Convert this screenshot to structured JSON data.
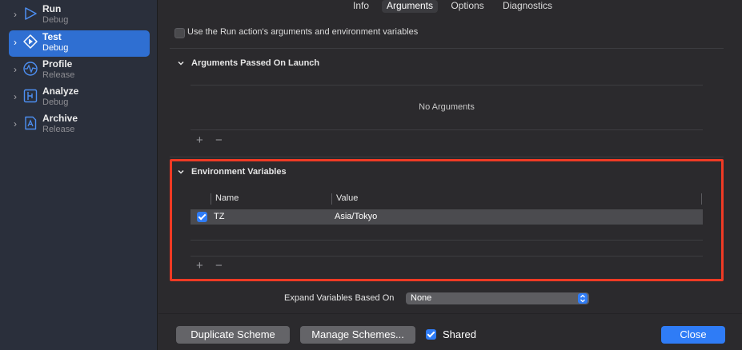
{
  "sidebar": {
    "items": [
      {
        "name": "Run",
        "sub": "Debug",
        "icon": "run-icon"
      },
      {
        "name": "Test",
        "sub": "Debug",
        "icon": "test-icon"
      },
      {
        "name": "Profile",
        "sub": "Release",
        "icon": "profile-icon"
      },
      {
        "name": "Analyze",
        "sub": "Debug",
        "icon": "analyze-icon"
      },
      {
        "name": "Archive",
        "sub": "Release",
        "icon": "archive-icon"
      }
    ],
    "selected_index": 1
  },
  "tabs": [
    {
      "label": "Info"
    },
    {
      "label": "Arguments"
    },
    {
      "label": "Options"
    },
    {
      "label": "Diagnostics"
    }
  ],
  "active_tab": "Arguments",
  "use_run_action": {
    "label": "Use the Run action's arguments and environment variables",
    "checked": false
  },
  "arguments_section": {
    "title": "Arguments Passed On Launch",
    "empty_text": "No Arguments",
    "add_label": "+",
    "remove_label": "−"
  },
  "env_section": {
    "title": "Environment Variables",
    "columns": {
      "name": "Name",
      "value": "Value"
    },
    "rows": [
      {
        "enabled": true,
        "name": "TZ",
        "value": "Asia/Tokyo"
      }
    ],
    "add_label": "+",
    "remove_label": "−"
  },
  "expand_variables": {
    "label": "Expand Variables Based On",
    "value": "None"
  },
  "footer": {
    "duplicate_label": "Duplicate Scheme",
    "manage_label": "Manage Schemes...",
    "shared_label": "Shared",
    "shared_checked": true,
    "close_label": "Close"
  },
  "colors": {
    "accent": "#2f7cf6",
    "selection": "#2f6fd2",
    "highlight_box": "#ef3a24"
  }
}
